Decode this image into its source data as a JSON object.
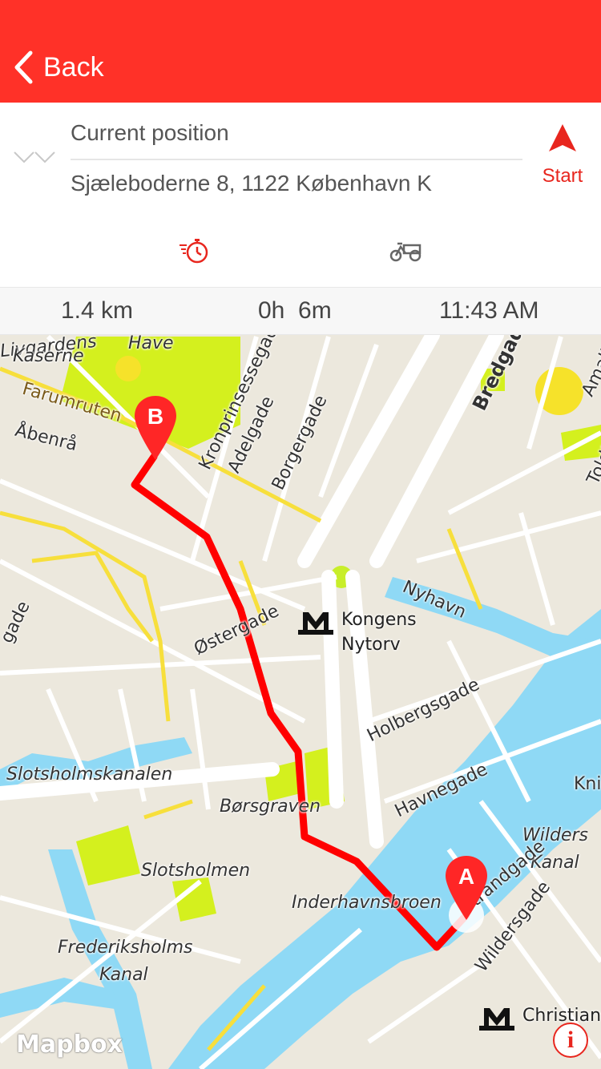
{
  "header": {
    "back_label": "Back",
    "background": "#ff3128"
  },
  "route": {
    "from": "Current position",
    "to": "Sjæleboderne 8, 1122 København K",
    "start_label": "Start",
    "modes": [
      {
        "icon": "stopwatch-fast-icon",
        "active": true
      },
      {
        "icon": "cargo-bike-icon",
        "active": false
      }
    ]
  },
  "summary": {
    "distance": "1.4 km",
    "duration": "0h  6m",
    "arrival": "11:43 AM"
  },
  "map": {
    "attribution": "Mapbox",
    "info_label": "i",
    "markers": [
      {
        "id": "origin",
        "label": "A"
      },
      {
        "id": "destination",
        "label": "B"
      }
    ],
    "metro_stations": [
      {
        "name": "Kongens\nNytorv",
        "symbol": "M"
      },
      {
        "name": "Christian",
        "symbol": "M"
      }
    ],
    "labels": {
      "livgarden": "Livgardens",
      "kaserne": "Kaserne",
      "have": "Have",
      "farumruten": "Farumruten",
      "abenra": "Åbenrå",
      "kronprinsessegade": "Kronprinsessegade",
      "adelgade": "Adelgade",
      "borgergade": "Borgergade",
      "bredgade": "Bredgade",
      "amaliegade": "Amaliegade",
      "toldbodgade": "Toldbodgade",
      "nyhavn": "Nyhavn",
      "ostergade": "Østergade",
      "holbergsgade": "Holbergsgade",
      "havnegade": "Havnegade",
      "knippelsbro": "Knip",
      "wilders_kanal_1": "Wilders",
      "wilders_kanal_2": "Kanal",
      "strandgade": "Strandgade",
      "wildersgade": "Wildersgade",
      "gade_left": "gade",
      "slotsholmskanalen": "Slotsholmskanalen",
      "borsgraven": "Børsgraven",
      "slotsholmen": "Slotsholmen",
      "inderhavnsbroen": "Inderhavnsbroen",
      "frederiksholms": "Frederiksholms",
      "kanal": "Kanal"
    },
    "route_color": "#ff0000",
    "water_color": "#8fd9f5",
    "park_color": "#d4f01e"
  }
}
